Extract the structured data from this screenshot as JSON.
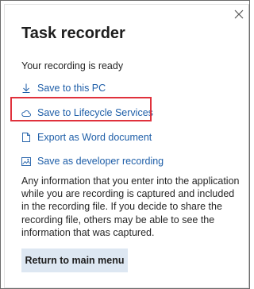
{
  "dialog": {
    "title": "Task recorder",
    "close_icon": "close-icon",
    "status": "Your recording is ready",
    "actions": [
      {
        "label": "Save to this PC",
        "icon": "download-icon"
      },
      {
        "label": "Save to Lifecycle Services",
        "icon": "cloud-icon",
        "highlighted": true
      },
      {
        "label": "Export as Word document",
        "icon": "document-icon"
      },
      {
        "label": "Save as developer recording",
        "icon": "image-icon"
      }
    ],
    "info": "Any information that you enter into the application while you are recording is captured and included in the recording file. If you decide to share the recording file, others may be able to see the information that was captured.",
    "main_button": "Return to main menu"
  },
  "colors": {
    "link": "#1e5ea8",
    "highlight_border": "#e0313c",
    "button_bg": "#dde7f2"
  }
}
